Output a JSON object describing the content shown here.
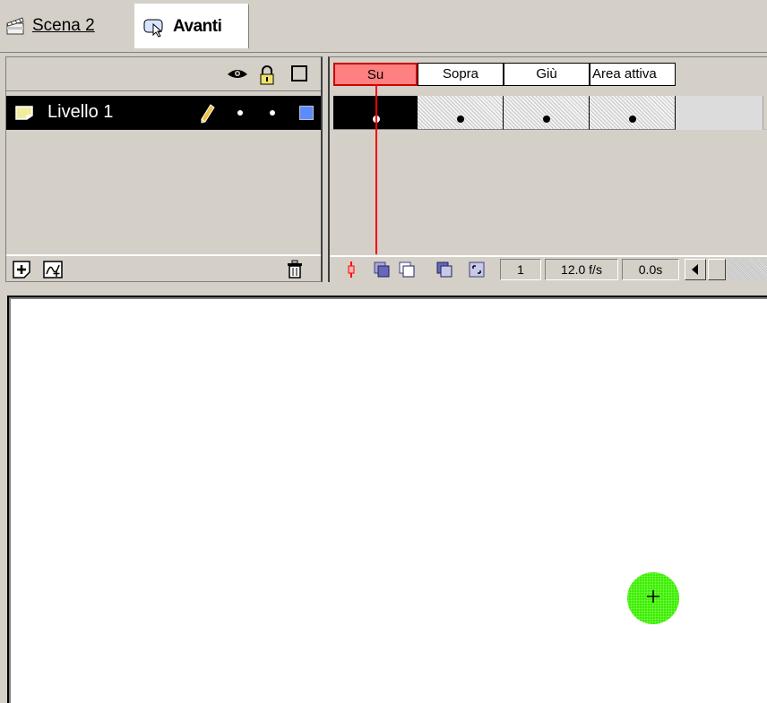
{
  "breadcrumb": {
    "scene_label": "Scena 2",
    "symbol_label": "Avanti"
  },
  "layers": {
    "header_icons": [
      "eye-icon",
      "lock-icon",
      "outline-icon"
    ],
    "rows": [
      {
        "name": "Livello 1",
        "color": "#5a8cff"
      }
    ],
    "footer_icons": [
      "insert-layer-icon",
      "add-guide-layer-icon",
      "trash-icon"
    ]
  },
  "frames": {
    "labels": [
      "Su",
      "Sopra",
      "Giù",
      "Area attiva"
    ],
    "active_label": "Su",
    "current_frame": "1",
    "frame_rate": "12.0 f/s",
    "elapsed_time": "0.0s"
  },
  "colors": {
    "playhead": "#ff0000",
    "active_frame_header": "#ff8080",
    "layer_selected_bg": "#000000",
    "button_fill": "#2ee600"
  }
}
